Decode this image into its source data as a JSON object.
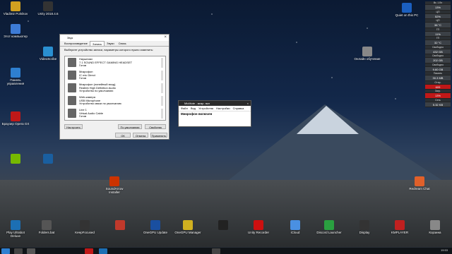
{
  "desktop_icons": [
    {
      "label": "Vladimir Polnikov",
      "color": "#d0a020"
    },
    {
      "label": "Unity 2018.4.6",
      "color": "#333"
    },
    {
      "label": "Этот компьютер",
      "color": "#3d7bd6"
    },
    {
      "label": "VideoScribe",
      "color": "#2a8fd0"
    },
    {
      "label": "Панель управления",
      "color": "#2e7fd0"
    },
    {
      "label": "Браузер Opera GX",
      "color": "#c01818"
    },
    {
      "label": "",
      "color": "#76b900"
    },
    {
      "label": "",
      "color": "#1a5fa0"
    },
    {
      "label": "Quiet on this PC",
      "color": "#1b5fbf"
    },
    {
      "label": "Онлайн обучение",
      "color": "#888"
    },
    {
      "label": "SoundArrow Installer",
      "color": "#cc3300"
    },
    {
      "label": "Redream Chat",
      "color": "#e0602a"
    },
    {
      "label": "Play Ultrabot Deluxe",
      "color": "#1c6fb4"
    },
    {
      "label": "Folders.bat",
      "color": "#555"
    },
    {
      "label": "KeepFocused",
      "color": "#333"
    },
    {
      "label": "",
      "color": "#c0392b"
    },
    {
      "label": "OneGPU Update",
      "color": "#1a4fa0"
    },
    {
      "label": "OneGPU Manager",
      "color": "#d0b020"
    },
    {
      "label": "",
      "color": "#222"
    },
    {
      "label": "Unity Recorder",
      "color": "#cc1010"
    },
    {
      "label": "iCloud",
      "color": "#4a90e2"
    },
    {
      "label": "Discord Launcher",
      "color": "#2aa040"
    },
    {
      "label": "Display",
      "color": "#333"
    },
    {
      "label": "KMPLAYER",
      "color": "#c02020"
    },
    {
      "label": "Корзина",
      "color": "#888"
    }
  ],
  "sound_dialog": {
    "title": "Звук",
    "tabs": [
      "Воспроизведение",
      "Запись",
      "Звуки",
      "Связь"
    ],
    "hint": "Выберите устройство записи, параметры которого нужно изменить:",
    "devices": [
      {
        "name": "Наушники",
        "l2": "7.1 SOUND EFFECT GAMING HEADSET",
        "l3": "Готов"
      },
      {
        "name": "Микрофон",
        "l2": "IC mic Direct",
        "l3": "Готов"
      },
      {
        "name": "Микрофон (линейный вход)",
        "l2": "Realtek High Definition Audio",
        "l3": "Устройство по умолчанию"
      },
      {
        "name": "Web-камера",
        "l2": "USB Microphone",
        "l3": "Устройство связи по умолчанию"
      },
      {
        "name": "Line 1",
        "l2": "Virtual Audio Cable",
        "l3": "Готов"
      }
    ],
    "configure": "Настроить",
    "default_btn": "По умолчанию",
    "properties": "Свойства",
    "ok": "ОК",
    "cancel": "Отмена",
    "apply": "Применить"
  },
  "micmute": {
    "title": "MicMute - микр. вкл",
    "menu": [
      "Файл",
      "Вид",
      "Устройства",
      "Настройки",
      "Справка"
    ],
    "status": "Микрофон включен"
  },
  "sys_panel": [
    {
      "label": "Вт, 1 Вт",
      "value": "13%",
      "red": false
    },
    {
      "label": "ЦП",
      "value": "52%",
      "red": false
    },
    {
      "label": "ЦП",
      "value": "38 °C",
      "red": false
    },
    {
      "label": "ГП",
      "value": "11%",
      "red": false
    },
    {
      "label": "ГП",
      "value": "32 °C",
      "red": false
    },
    {
      "label": "Свободно",
      "value": "432 GB",
      "red": false
    },
    {
      "label": "Свободно",
      "value": "202 GB",
      "red": false
    },
    {
      "label": "Свободно",
      "value": "9.60 GB",
      "red": false
    },
    {
      "label": "Память",
      "value": "30.3 MB",
      "red": false
    },
    {
      "label": "Отпр.",
      "value": "609",
      "red": true
    },
    {
      "label": "Загр.",
      "value": "13%",
      "red": true
    },
    {
      "label": "Сеть",
      "value": "5.32 KB",
      "red": false
    }
  ],
  "clock": "19:53"
}
